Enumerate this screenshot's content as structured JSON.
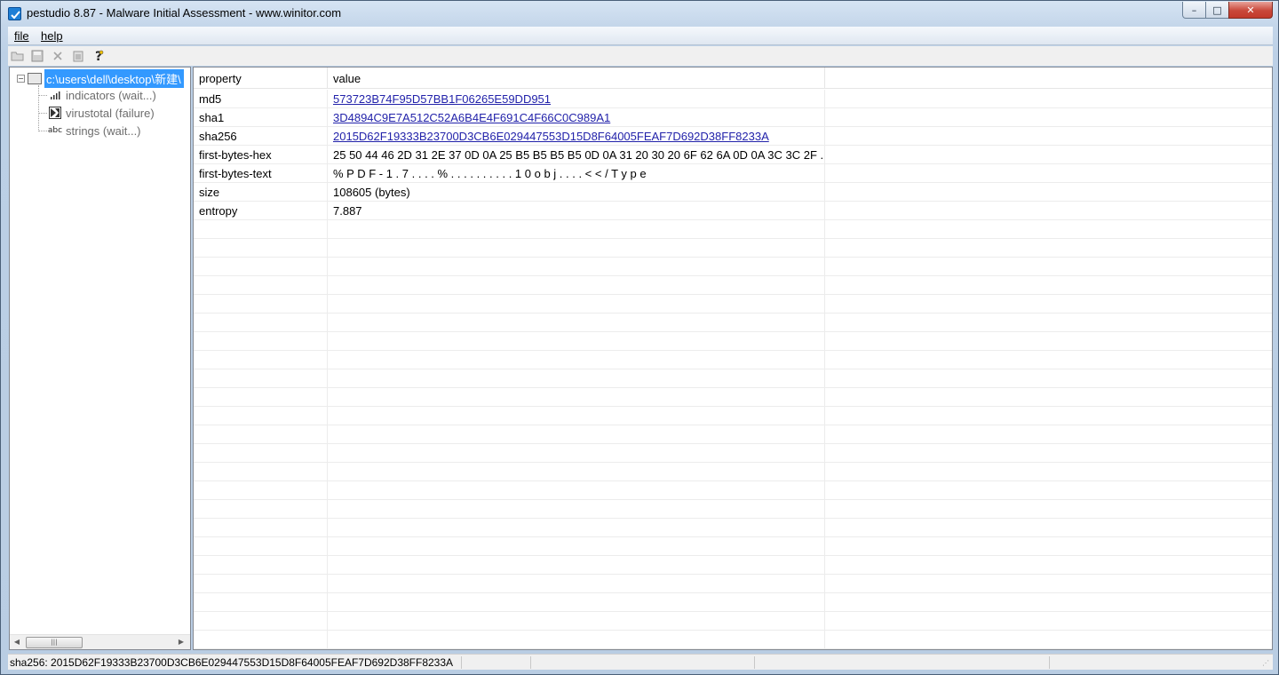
{
  "window": {
    "title": "pestudio 8.87 - Malware Initial Assessment - www.winitor.com",
    "controls": {
      "minimize": "–",
      "maximize": "□",
      "close": "✕"
    }
  },
  "menu": {
    "items": [
      {
        "label": "file"
      },
      {
        "label": "help"
      }
    ]
  },
  "toolbar": {
    "icons": [
      "open-icon",
      "save-icon",
      "close-file-icon",
      "clipboard-icon",
      "help-icon"
    ]
  },
  "tree": {
    "root": {
      "label": "c:\\users\\dell\\desktop\\新建\\",
      "expander": "−"
    },
    "children": [
      {
        "label": "indicators (wait...)",
        "icon": "bar-chart-icon"
      },
      {
        "label": "virustotal (failure)",
        "icon": "virustotal-icon"
      },
      {
        "label": "strings (wait...)",
        "icon": "abc-icon",
        "icon_text": "abc"
      }
    ]
  },
  "table": {
    "columns": [
      "property",
      "value",
      ""
    ],
    "rows": [
      {
        "property": "md5",
        "value": "573723B74F95D57BB1F06265E59DD951",
        "link": true
      },
      {
        "property": "sha1",
        "value": "3D4894C9E7A512C52A6B4E4F691C4F66C0C989A1",
        "link": true
      },
      {
        "property": "sha256",
        "value": "2015D62F19333B23700D3CB6E029447553D15D8F64005FEAF7D692D38FF8233A",
        "link": true
      },
      {
        "property": "first-bytes-hex",
        "value": "25 50 44 46 2D 31 2E 37 0D 0A 25 B5 B5 B5 B5 0D 0A 31 20 30 20 6F 62 6A 0D 0A 3C 3C 2F ...",
        "link": false
      },
      {
        "property": "first-bytes-text",
        "value": "% P D F - 1 . 7 . . . . % . . . . . . . . . . 1   0   o b j . . . . < < / T y p e",
        "link": false
      },
      {
        "property": "size",
        "value": "108605 (bytes)",
        "link": false
      },
      {
        "property": "entropy",
        "value": "7.887",
        "link": false
      }
    ],
    "empty_rows": 23
  },
  "statusbar": {
    "text": "sha256: 2015D62F19333B23700D3CB6E029447553D15D8F64005FEAF7D692D38FF8233A"
  },
  "colors": {
    "selection": "#3399ff",
    "link": "#2222aa",
    "title_gradient_top": "#d6e4f3"
  }
}
